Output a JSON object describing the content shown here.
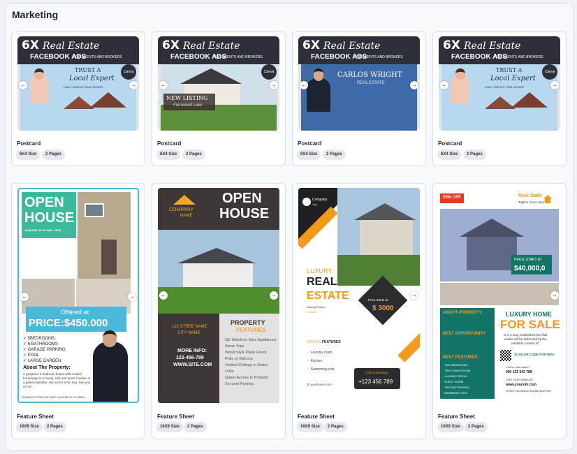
{
  "section_title": "Marketing",
  "postcard_banner": {
    "big": "6X",
    "script": "Real Estate",
    "facebook": "FACEBOOK ADS",
    "sub": "FOR AGENTS AND BROKERS",
    "canva": "Canva",
    "trust1": "TRUST A",
    "trust2": "Local Expert",
    "trust3": "LINDY WRIGHT REAL ESTATE",
    "new_listing": "NEW LISTING",
    "new_listing_sub": "Fernwood Lake",
    "agent_name": "CARLOS WRIGHT",
    "agent_role": "REAL ESTATE"
  },
  "postcards": [
    {
      "title": "Postcard",
      "size": "6X4 Size",
      "pages": "2 Pages"
    },
    {
      "title": "Postcard",
      "size": "6X4 Size",
      "pages": "2 Pages"
    },
    {
      "title": "Postcard",
      "size": "6X4 Size",
      "pages": "2 Pages"
    },
    {
      "title": "Postcard",
      "size": "6X4 Size",
      "pages": "2 Pages"
    }
  ],
  "feature_sheets": [
    {
      "title": "Feature Sheet",
      "size": "16X9 Size",
      "pages": "2 Pages"
    },
    {
      "title": "Feature Sheet",
      "size": "16X9 Size",
      "pages": "2 Pages"
    },
    {
      "title": "Feature Sheet",
      "size": "16X9 Size",
      "pages": "2 Pages"
    },
    {
      "title": "Feature Sheet",
      "size": "16X9 Size",
      "pages": "2 Pages"
    }
  ],
  "fs1": {
    "open": "OPEN",
    "house": "HOUSE",
    "date": "JANUARY 13-18 6AM - 9PM",
    "offered": "Offered at:",
    "price": "PRICE:$450.000",
    "bullets": [
      "5BEDROOMS,",
      "6 BATHROOMS",
      "GARAGE PARKING,",
      "POOL",
      "LARGE GARDEN"
    ],
    "about": "About The Property:",
    "desc": "A gorgeous 6 bedroom house with modern furnishings in a lovely, safe and prime location in a gated township. Join us for a fun tour. See you on us!",
    "address": "55 MASON STREET ATLANTIS, PALM BEACH FLORIDA"
  },
  "fs2": {
    "company": "COMPANY",
    "name": "NAME",
    "open": "OPEN",
    "house": "HOUSE",
    "street": "123 STREE NAME",
    "city": "CITY NAME",
    "more": "MORE INFO:",
    "phone": "123-456-789",
    "site": "WWW.SITE.COM",
    "property": "PROPERTY",
    "features": "FEATURES",
    "list": [
      "GE Stainless Style Appliances",
      "Stone Tops",
      "Wood Style Plank Floors",
      "Patio or Balcony",
      "Vaulted Ceilings in Select Units",
      "Gated Access to Property",
      "Secured Parking"
    ]
  },
  "fs3": {
    "company": "Company",
    "logo": "logo",
    "luxury": "LUXURY",
    "real": "REAL",
    "estate": "ESTATE",
    "making": "Making Reality",
    "dreams": "Dreams",
    "price_label": "Price Starts at",
    "price": "$ 3000",
    "special": "SPECIAL",
    "features": "FEATURES",
    "list": [
      "Laundry room",
      "Kitchen",
      "Swimming pool"
    ],
    "call": "Call for Booking",
    "phone": "+123 456 789",
    "site": "@ yourhome.com"
  },
  "fs4": {
    "discount": "25% OFF",
    "brand": "Real State",
    "tagline": "Tagline Goes Here",
    "price_label": "PRICE START AT",
    "price": "$40,000,0",
    "about": "ABOUT PROPERTY",
    "best": "BEST OPPORTUNITY",
    "features": "BEST FEATURES",
    "list": [
      "TWO BEDROOMS",
      "TWO LIVING ROOM",
      "LAUNDRY ROOM",
      "GUEST ROOM",
      "TWO BATHROOMS",
      "SWIMMING POOL"
    ],
    "luxury": "LUXURY HOME",
    "for_sale": "FOR SALE",
    "quote": "\"It is a long established fact that reader will be distracted by the readable content of\"",
    "scan": "SCAN OR CODE FOR INFO",
    "call": "Call for information",
    "phone": "000 123 542 789",
    "visit": "VISIT OUR WEBSITE",
    "site": "www.yoursite.com",
    "addr": "25 New York Medical Hospital Name Here"
  },
  "colors": {
    "accent_green": "#3bb99a",
    "teal": "#137568",
    "orange": "#f39a1b",
    "red": "#e33b22",
    "dark": "#2d3038"
  }
}
